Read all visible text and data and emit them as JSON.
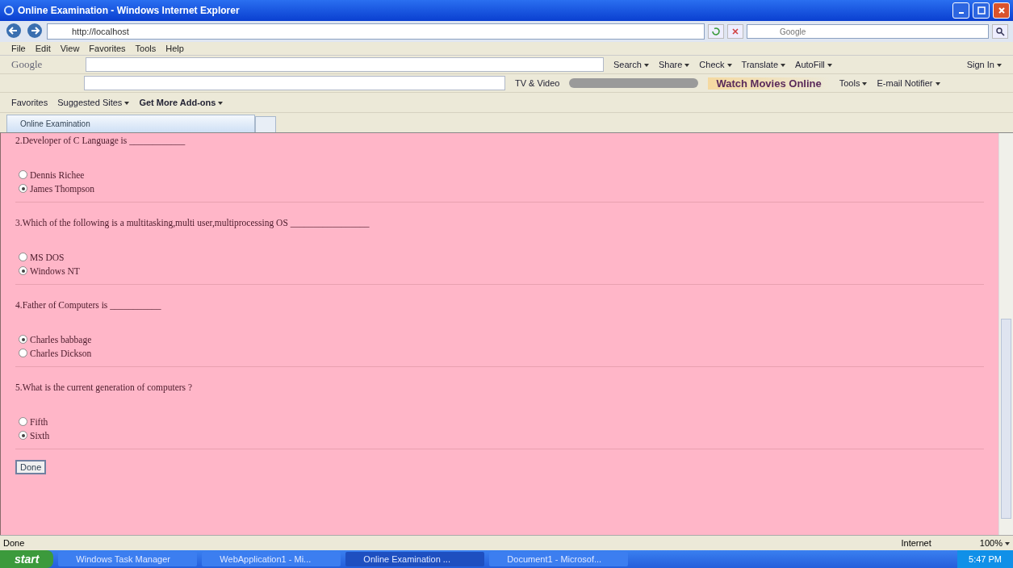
{
  "window": {
    "title": "Online Examination - Windows Internet Explorer"
  },
  "address_bar": {
    "url": "http://localhost"
  },
  "search_box": {
    "placeholder": "Google"
  },
  "menu": [
    "File",
    "Edit",
    "View",
    "Favorites",
    "Tools",
    "Help"
  ],
  "google_toolbar": {
    "logo": "Google",
    "items": [
      "Search",
      "Share",
      "Check",
      "Translate",
      "AutoFill"
    ],
    "sign_in": "Sign In"
  },
  "toolbar2": {
    "items": [
      "TV & Video"
    ],
    "promo": "Watch Movies Online",
    "right_items": [
      "Tools",
      "E-mail Notifier"
    ]
  },
  "favorites_bar": {
    "label": "Favorites",
    "items": [
      "Suggested Sites",
      "Get More Add-ons"
    ]
  },
  "tabs": [
    {
      "label": "Online Examination",
      "selected": true
    }
  ],
  "questions": [
    {
      "text": "2.Developer of C Language is ____________",
      "options": [
        {
          "label": "Dennis Richee",
          "selected": false
        },
        {
          "label": "James Thompson",
          "selected": true
        }
      ]
    },
    {
      "text": "3.Which of the following is a multitasking,multi user,multiprocessing OS _________________",
      "options": [
        {
          "label": "MS DOS",
          "selected": false
        },
        {
          "label": "Windows NT",
          "selected": true
        }
      ]
    },
    {
      "text": "4.Father of Computers is ___________",
      "options": [
        {
          "label": "Charles babbage",
          "selected": true
        },
        {
          "label": "Charles Dickson",
          "selected": false
        }
      ]
    },
    {
      "text": "5.What is the current generation of computers ?",
      "options": [
        {
          "label": "Fifth",
          "selected": false
        },
        {
          "label": "Sixth",
          "selected": true
        }
      ]
    }
  ],
  "done_button": "Done",
  "status_bar": {
    "text": "Done",
    "zone": "Internet",
    "zoom": "100%"
  },
  "taskbar": {
    "start": "start",
    "tasks": [
      {
        "label": "Windows Task Manager",
        "selected": false
      },
      {
        "label": "WebApplication1 - Mi...",
        "selected": false
      },
      {
        "label": "Online Examination ...",
        "selected": true
      },
      {
        "label": "Document1 - Microsof...",
        "selected": false
      }
    ],
    "clock": "5:47 PM"
  }
}
